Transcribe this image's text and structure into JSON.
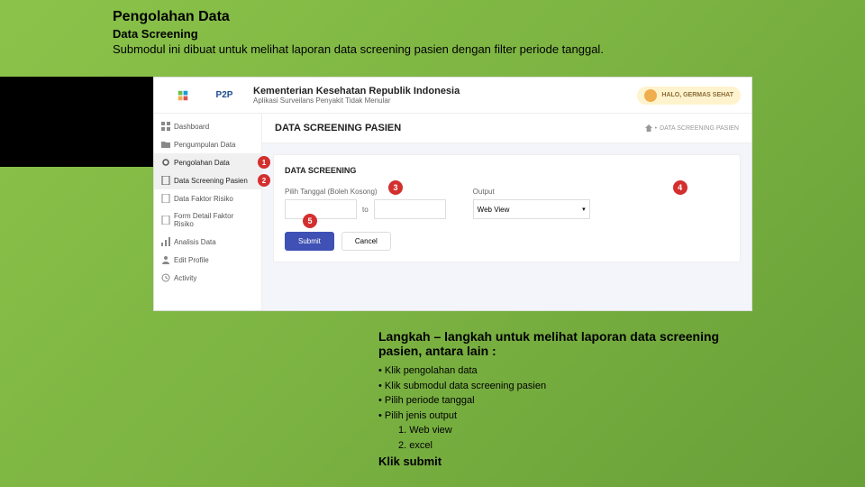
{
  "slide": {
    "title": "Pengolahan Data",
    "subtitle": "Data Screening",
    "description": "Submodul ini dibuat untuk melihat laporan data screening pasien dengan filter periode tanggal."
  },
  "app": {
    "logo_text": "P2P",
    "header_title": "Kementerian Kesehatan Republik Indonesia",
    "header_sub": "Aplikasi Surveilans Penyakit Tidak Menular",
    "user_label": "HALO, GERMAS SEHAT"
  },
  "sidebar": {
    "items": [
      {
        "icon": "grid",
        "label": "Dashboard"
      },
      {
        "icon": "folder",
        "label": "Pengumpulan Data"
      },
      {
        "icon": "gear",
        "label": "Pengolahan Data",
        "badge": "1"
      },
      {
        "icon": "doc",
        "label": "Data Screening Pasien",
        "badge": "2"
      },
      {
        "icon": "doc",
        "label": "Data Faktor Risiko"
      },
      {
        "icon": "doc",
        "label": "Form Detail Faktor Risiko"
      },
      {
        "icon": "chart",
        "label": "Analisis Data"
      },
      {
        "icon": "user",
        "label": "Edit Profile"
      },
      {
        "icon": "clock",
        "label": "Activity"
      }
    ]
  },
  "page": {
    "title": "DATA SCREENING PASIEN",
    "breadcrumb_sep": "•",
    "breadcrumb": "DATA SCREENING PASIEN"
  },
  "card": {
    "title": "DATA SCREENING",
    "date_label": "Pilih Tanggal (Boleh Kosong)",
    "to": "to",
    "output_label": "Output",
    "output_value": "Web View",
    "submit": "Submit",
    "cancel": "Cancel"
  },
  "markers": {
    "m3": "3",
    "m4": "4",
    "m5": "5"
  },
  "steps": {
    "title": "Langkah – langkah untuk melihat laporan data screening pasien, antara lain :",
    "items": [
      "• Klik pengolahan data",
      "• Klik submodul data screening pasien",
      "• Pilih periode tanggal",
      "• Pilih jenis output"
    ],
    "sub": [
      "1. Web view",
      "2. excel"
    ],
    "final": "Klik submit"
  }
}
